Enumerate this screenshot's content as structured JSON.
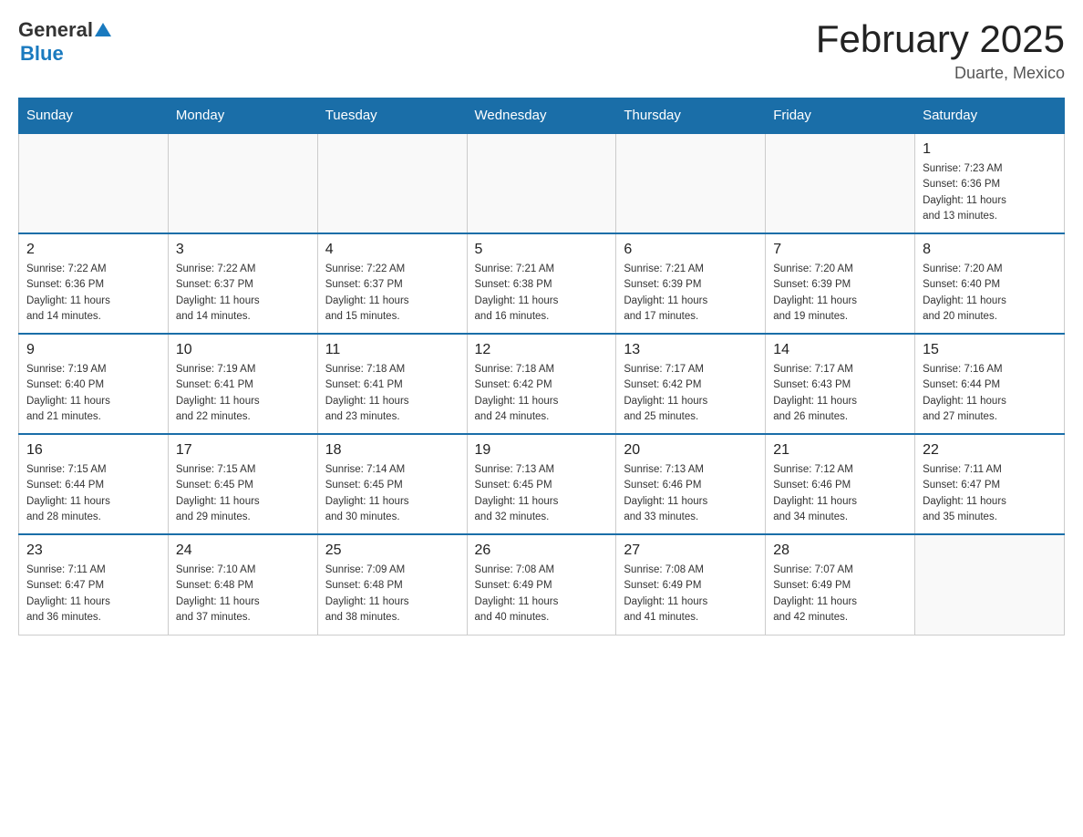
{
  "header": {
    "logo": {
      "general": "General",
      "blue": "Blue"
    },
    "title": "February 2025",
    "location": "Duarte, Mexico"
  },
  "days_of_week": [
    "Sunday",
    "Monday",
    "Tuesday",
    "Wednesday",
    "Thursday",
    "Friday",
    "Saturday"
  ],
  "weeks": [
    {
      "days": [
        {
          "number": "",
          "info": "",
          "empty": true
        },
        {
          "number": "",
          "info": "",
          "empty": true
        },
        {
          "number": "",
          "info": "",
          "empty": true
        },
        {
          "number": "",
          "info": "",
          "empty": true
        },
        {
          "number": "",
          "info": "",
          "empty": true
        },
        {
          "number": "",
          "info": "",
          "empty": true
        },
        {
          "number": "1",
          "info": "Sunrise: 7:23 AM\nSunset: 6:36 PM\nDaylight: 11 hours\nand 13 minutes.",
          "empty": false
        }
      ]
    },
    {
      "days": [
        {
          "number": "2",
          "info": "Sunrise: 7:22 AM\nSunset: 6:36 PM\nDaylight: 11 hours\nand 14 minutes.",
          "empty": false
        },
        {
          "number": "3",
          "info": "Sunrise: 7:22 AM\nSunset: 6:37 PM\nDaylight: 11 hours\nand 14 minutes.",
          "empty": false
        },
        {
          "number": "4",
          "info": "Sunrise: 7:22 AM\nSunset: 6:37 PM\nDaylight: 11 hours\nand 15 minutes.",
          "empty": false
        },
        {
          "number": "5",
          "info": "Sunrise: 7:21 AM\nSunset: 6:38 PM\nDaylight: 11 hours\nand 16 minutes.",
          "empty": false
        },
        {
          "number": "6",
          "info": "Sunrise: 7:21 AM\nSunset: 6:39 PM\nDaylight: 11 hours\nand 17 minutes.",
          "empty": false
        },
        {
          "number": "7",
          "info": "Sunrise: 7:20 AM\nSunset: 6:39 PM\nDaylight: 11 hours\nand 19 minutes.",
          "empty": false
        },
        {
          "number": "8",
          "info": "Sunrise: 7:20 AM\nSunset: 6:40 PM\nDaylight: 11 hours\nand 20 minutes.",
          "empty": false
        }
      ]
    },
    {
      "days": [
        {
          "number": "9",
          "info": "Sunrise: 7:19 AM\nSunset: 6:40 PM\nDaylight: 11 hours\nand 21 minutes.",
          "empty": false
        },
        {
          "number": "10",
          "info": "Sunrise: 7:19 AM\nSunset: 6:41 PM\nDaylight: 11 hours\nand 22 minutes.",
          "empty": false
        },
        {
          "number": "11",
          "info": "Sunrise: 7:18 AM\nSunset: 6:41 PM\nDaylight: 11 hours\nand 23 minutes.",
          "empty": false
        },
        {
          "number": "12",
          "info": "Sunrise: 7:18 AM\nSunset: 6:42 PM\nDaylight: 11 hours\nand 24 minutes.",
          "empty": false
        },
        {
          "number": "13",
          "info": "Sunrise: 7:17 AM\nSunset: 6:42 PM\nDaylight: 11 hours\nand 25 minutes.",
          "empty": false
        },
        {
          "number": "14",
          "info": "Sunrise: 7:17 AM\nSunset: 6:43 PM\nDaylight: 11 hours\nand 26 minutes.",
          "empty": false
        },
        {
          "number": "15",
          "info": "Sunrise: 7:16 AM\nSunset: 6:44 PM\nDaylight: 11 hours\nand 27 minutes.",
          "empty": false
        }
      ]
    },
    {
      "days": [
        {
          "number": "16",
          "info": "Sunrise: 7:15 AM\nSunset: 6:44 PM\nDaylight: 11 hours\nand 28 minutes.",
          "empty": false
        },
        {
          "number": "17",
          "info": "Sunrise: 7:15 AM\nSunset: 6:45 PM\nDaylight: 11 hours\nand 29 minutes.",
          "empty": false
        },
        {
          "number": "18",
          "info": "Sunrise: 7:14 AM\nSunset: 6:45 PM\nDaylight: 11 hours\nand 30 minutes.",
          "empty": false
        },
        {
          "number": "19",
          "info": "Sunrise: 7:13 AM\nSunset: 6:45 PM\nDaylight: 11 hours\nand 32 minutes.",
          "empty": false
        },
        {
          "number": "20",
          "info": "Sunrise: 7:13 AM\nSunset: 6:46 PM\nDaylight: 11 hours\nand 33 minutes.",
          "empty": false
        },
        {
          "number": "21",
          "info": "Sunrise: 7:12 AM\nSunset: 6:46 PM\nDaylight: 11 hours\nand 34 minutes.",
          "empty": false
        },
        {
          "number": "22",
          "info": "Sunrise: 7:11 AM\nSunset: 6:47 PM\nDaylight: 11 hours\nand 35 minutes.",
          "empty": false
        }
      ]
    },
    {
      "days": [
        {
          "number": "23",
          "info": "Sunrise: 7:11 AM\nSunset: 6:47 PM\nDaylight: 11 hours\nand 36 minutes.",
          "empty": false
        },
        {
          "number": "24",
          "info": "Sunrise: 7:10 AM\nSunset: 6:48 PM\nDaylight: 11 hours\nand 37 minutes.",
          "empty": false
        },
        {
          "number": "25",
          "info": "Sunrise: 7:09 AM\nSunset: 6:48 PM\nDaylight: 11 hours\nand 38 minutes.",
          "empty": false
        },
        {
          "number": "26",
          "info": "Sunrise: 7:08 AM\nSunset: 6:49 PM\nDaylight: 11 hours\nand 40 minutes.",
          "empty": false
        },
        {
          "number": "27",
          "info": "Sunrise: 7:08 AM\nSunset: 6:49 PM\nDaylight: 11 hours\nand 41 minutes.",
          "empty": false
        },
        {
          "number": "28",
          "info": "Sunrise: 7:07 AM\nSunset: 6:49 PM\nDaylight: 11 hours\nand 42 minutes.",
          "empty": false
        },
        {
          "number": "",
          "info": "",
          "empty": true
        }
      ]
    }
  ]
}
